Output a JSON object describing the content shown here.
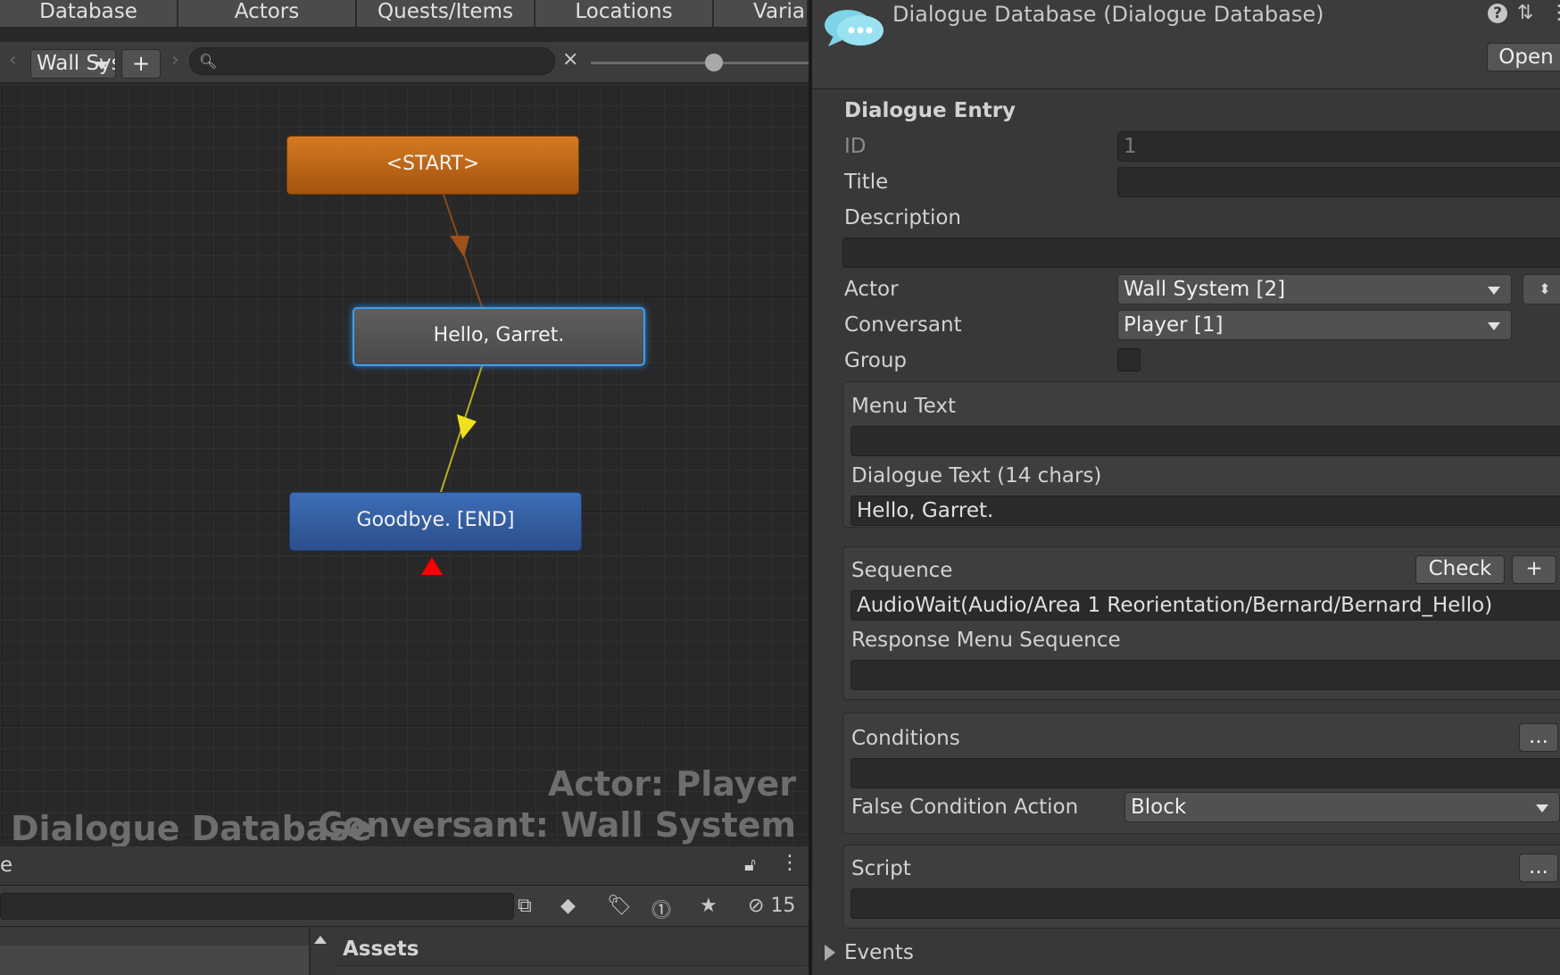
{
  "tabs": [
    "Database",
    "Actors",
    "Quests/Items",
    "Locations",
    "Varia"
  ],
  "toolbar": {
    "actor_select": "Wall System",
    "add_label": "+",
    "clear_label": "×"
  },
  "nodes": {
    "start": "<START>",
    "hello": "Hello, Garret.",
    "end": "Goodbye. [END]"
  },
  "watermarks": {
    "database": "Dialogue Database",
    "actor": "Actor: Player",
    "conversant": "Conversant: Wall System"
  },
  "project": {
    "title_fragment": "e",
    "hidden_count": "15",
    "assets_label": "Assets"
  },
  "inspector": {
    "title": "Dialogue Database (Dialogue Database)",
    "open_label": "Open",
    "section_title": "Dialogue Entry",
    "id_label": "ID",
    "id_value": "1",
    "title_label": "Title",
    "title_value": "",
    "description_label": "Description",
    "description_value": "",
    "actor_label": "Actor",
    "actor_value": "Wall System [2]",
    "conversant_label": "Conversant",
    "conversant_value": "Player [1]",
    "group_label": "Group",
    "group_checked": false,
    "menu_text_label": "Menu Text",
    "menu_text_value": "",
    "dialogue_text_label": "Dialogue Text (14 chars)",
    "dialogue_text_value": "Hello, Garret.",
    "sequence_label": "Sequence",
    "check_label": "Check",
    "plus_label": "+",
    "sequence_value": "AudioWait(Audio/Area 1 Reorientation/Bernard/Bernard_Hello)",
    "response_menu_label": "Response Menu Sequence",
    "response_menu_value": "",
    "conditions_label": "Conditions",
    "ellipsis_label": "...",
    "conditions_value": "",
    "false_action_label": "False Condition Action",
    "false_action_value": "Block",
    "script_label": "Script",
    "script_value": "",
    "events_label": "Events"
  },
  "colors": {
    "start_node": "#c46c1a",
    "hello_node": "#555555",
    "end_node": "#3461a6",
    "selected_outline": "#3aa0f0",
    "link_start": "#8a4a1c",
    "link_hello": "#c8c020",
    "end_marker": "#e00000"
  }
}
